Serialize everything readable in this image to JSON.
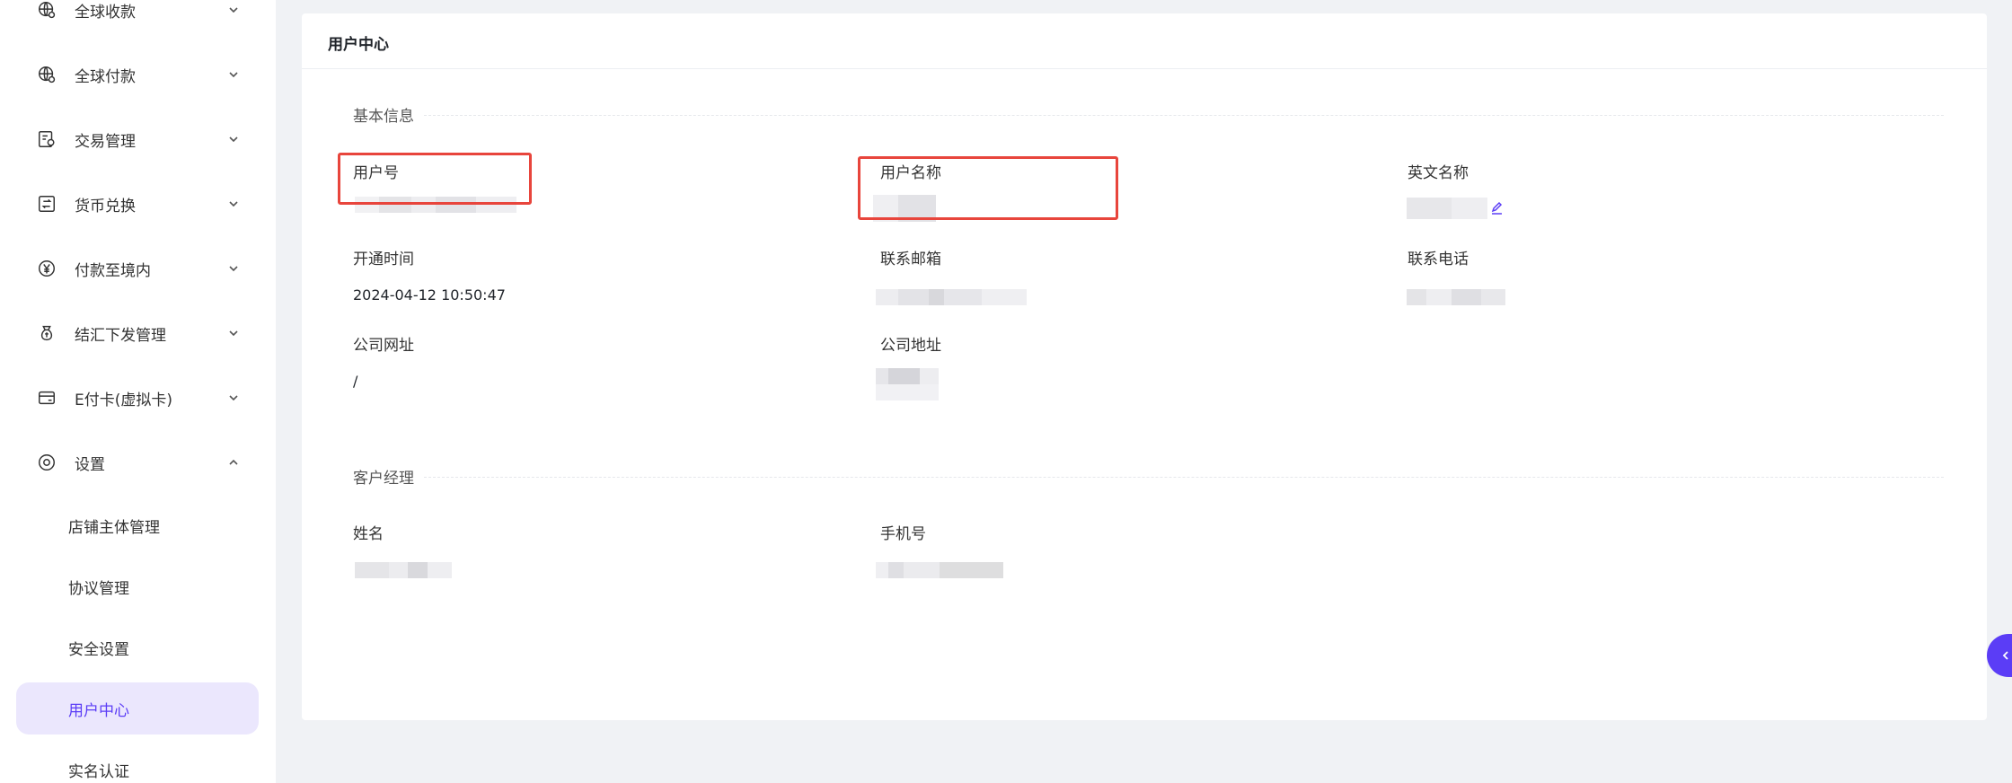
{
  "sidebar": {
    "items": [
      {
        "label": "全球收款",
        "icon": "globe-receive-icon",
        "expanded": false
      },
      {
        "label": "全球付款",
        "icon": "globe-pay-icon",
        "expanded": false
      },
      {
        "label": "交易管理",
        "icon": "transaction-icon",
        "expanded": false
      },
      {
        "label": "货币兑换",
        "icon": "currency-exchange-icon",
        "expanded": false
      },
      {
        "label": "付款至境内",
        "icon": "yuan-icon",
        "expanded": false
      },
      {
        "label": "结汇下发管理",
        "icon": "money-bag-icon",
        "expanded": false
      },
      {
        "label": "E付卡(虚拟卡)",
        "icon": "card-icon",
        "expanded": false
      },
      {
        "label": "设置",
        "icon": "settings-icon",
        "expanded": true
      }
    ],
    "sub_items": [
      {
        "label": "店铺主体管理",
        "active": false
      },
      {
        "label": "协议管理",
        "active": false
      },
      {
        "label": "安全设置",
        "active": false
      },
      {
        "label": "用户中心",
        "active": true
      },
      {
        "label": "实名认证",
        "active": false
      }
    ]
  },
  "page": {
    "title": "用户中心",
    "basic_info": {
      "section_title": "基本信息",
      "fields": {
        "user_id": {
          "label": "用户号",
          "value": ""
        },
        "user_name": {
          "label": "用户名称",
          "value": ""
        },
        "english_name": {
          "label": "英文名称",
          "value": ""
        },
        "open_time": {
          "label": "开通时间",
          "value": "2024-04-12 10:50:47"
        },
        "email": {
          "label": "联系邮箱",
          "value": ""
        },
        "phone": {
          "label": "联系电话",
          "value": ""
        },
        "website": {
          "label": "公司网址",
          "value": "/"
        },
        "address": {
          "label": "公司地址",
          "value": ""
        }
      }
    },
    "manager": {
      "section_title": "客户经理",
      "fields": {
        "name": {
          "label": "姓名",
          "value": ""
        },
        "mobile": {
          "label": "手机号",
          "value": ""
        }
      }
    }
  },
  "colors": {
    "accent": "#5b3df6",
    "active_bg": "#ebe7fd",
    "highlight": "#e8453c",
    "background": "#f0f2f5"
  }
}
